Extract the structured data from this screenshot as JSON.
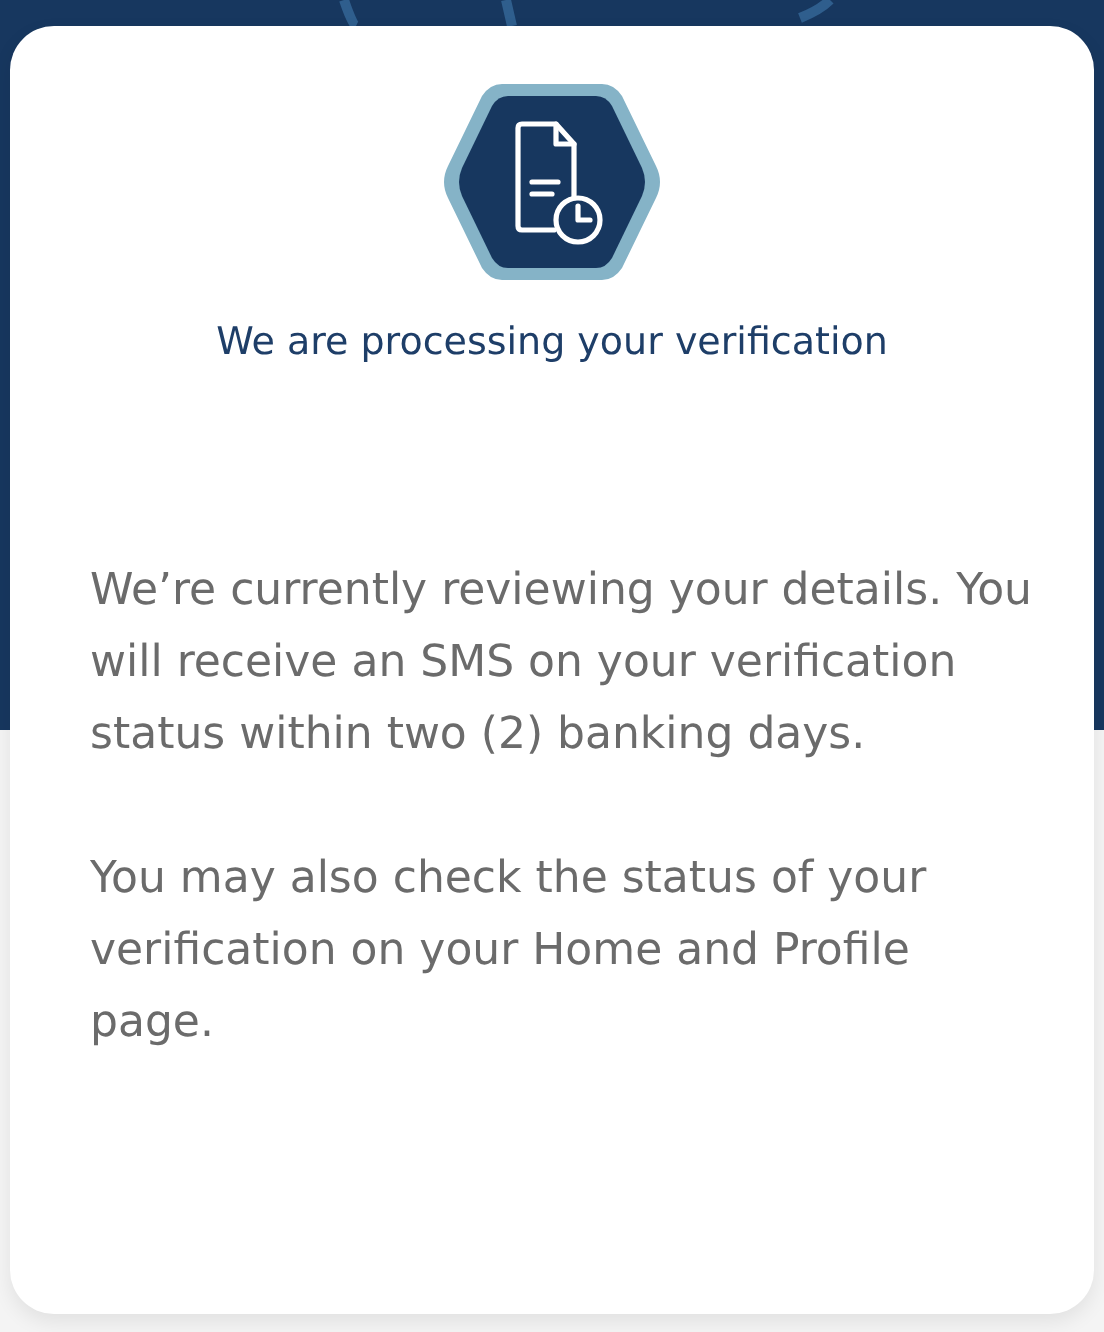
{
  "title": "We are processing your verification",
  "paragraphs": [
    "We’re currently reviewing your details. You will receive an SMS on your verification status within two (2) banking days.",
    "You may also check the status of your verification on your Home and Profile page."
  ]
}
